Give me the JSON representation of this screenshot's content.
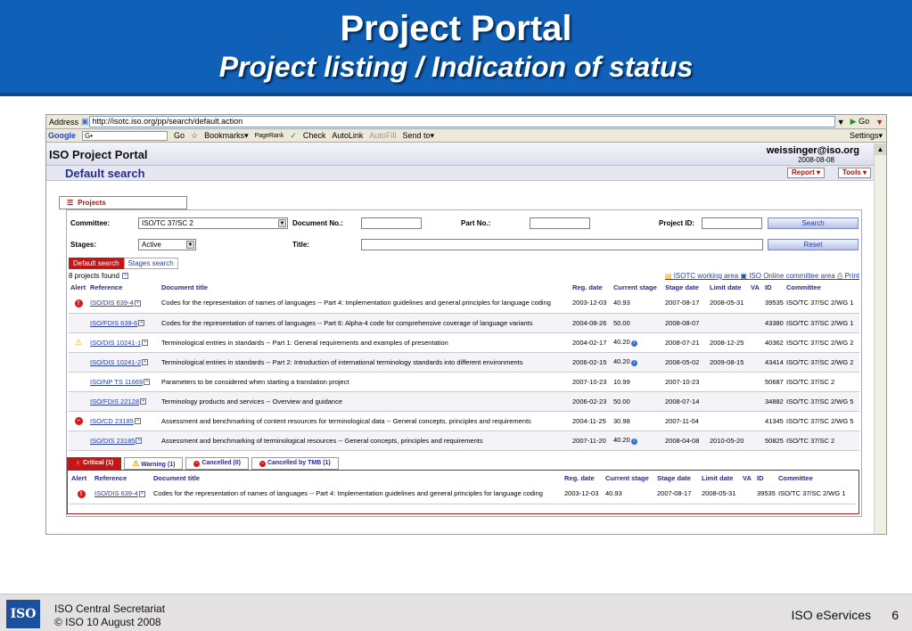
{
  "slide": {
    "title": "Project Portal",
    "subtitle": "Project listing / Indication of status"
  },
  "browser": {
    "address_label": "Address",
    "url": "http://isotc.iso.org/pp/search/default.action",
    "go_label": "Go",
    "google_label": "Google",
    "google_input": "G•",
    "toolbar_go": "Go",
    "bookmarks": "Bookmarks▾",
    "pagerank": "PageRank",
    "check": "Check",
    "autolink": "AutoLink",
    "autofill": "AutoFill",
    "send_to": "Send to▾",
    "settings": "Settings▾"
  },
  "portal": {
    "title": "ISO Project Portal",
    "user": "weissinger@iso.org",
    "date": "2008-08-08",
    "subtitle": "Default search",
    "report_btn": "Report",
    "tools_btn": "Tools"
  },
  "projects_tab": "Projects",
  "form": {
    "committee_label": "Committee:",
    "committee_value": "ISO/TC 37/SC 2",
    "docno_label": "Document No.:",
    "partno_label": "Part No.:",
    "projectid_label": "Project ID:",
    "search_btn": "Search",
    "stages_label": "Stages:",
    "stages_value": "Active",
    "title_label": "Title:",
    "reset_btn": "Reset"
  },
  "subtabs": [
    "Default search",
    "Stages search"
  ],
  "found": "8 projects found",
  "links": {
    "isotc": "ISOTC working area",
    "online": "ISO Online committee area",
    "print": "Print"
  },
  "table": {
    "headers": [
      "Alert",
      "Reference",
      "Document title",
      "Reg. date",
      "Current stage",
      "Stage date",
      "Limit date",
      "VA",
      "ID",
      "Committee"
    ],
    "rows": [
      {
        "alert": "critical",
        "ref": "ISO/DIS 639-4",
        "title": "Codes for the representation of names of languages -- Part 4: Implementation guidelines and general principles for language coding",
        "reg": "2003-12-03",
        "stage": "40.93",
        "stage_date": "2007-08-17",
        "limit": "2008-05-31",
        "va": "",
        "id": "39535",
        "committee": "ISO/TC 37/SC 2/WG 1"
      },
      {
        "alert": "",
        "ref": "ISO/FDIS 639-6",
        "title": "Codes for the representation of names of languages -- Part 6: Alpha-4 code for comprehensive coverage of language variants",
        "reg": "2004-08-26",
        "stage": "50.00",
        "stage_date": "2008-08-07",
        "limit": "",
        "va": "",
        "id": "43380",
        "committee": "ISO/TC 37/SC 2/WG 1"
      },
      {
        "alert": "warning",
        "ref": "ISO/DIS 10241-1",
        "title": "Terminological entries in standards -- Part 1: General requirements and examples of presentation",
        "reg": "2004-02-17",
        "stage": "40.20",
        "stage_date": "2008-07-21",
        "limit": "2008-12-25",
        "va": "",
        "id": "40362",
        "committee": "ISO/TC 37/SC 2/WG 2"
      },
      {
        "alert": "",
        "ref": "ISO/DIS 10241-2",
        "title": "Terminological entries in standards -- Part 2: Introduction of international terminology standards into different environments",
        "reg": "2006-02-15",
        "stage": "40.20",
        "stage_date": "2008-05-02",
        "limit": "2009-08-15",
        "va": "",
        "id": "43414",
        "committee": "ISO/TC 37/SC 2/WG 2"
      },
      {
        "alert": "",
        "ref": "ISO/NP TS 11669",
        "title": "Parameters to be considered when starting a translation project",
        "reg": "2007-10-23",
        "stage": "10.99",
        "stage_date": "2007-10-23",
        "limit": "",
        "va": "",
        "id": "50687",
        "committee": "ISO/TC 37/SC 2"
      },
      {
        "alert": "",
        "ref": "ISO/FDIS 22128",
        "title": "Terminology products and services -- Overview and guidance",
        "reg": "2006-02-23",
        "stage": "50.00",
        "stage_date": "2008-07-14",
        "limit": "",
        "va": "",
        "id": "34882",
        "committee": "ISO/TC 37/SC 2/WG 5"
      },
      {
        "alert": "cancelled",
        "ref": "ISO/CD 23185",
        "title": "Assessment and benchmarking of content resources for terminological data -- General concepts, principles and requirements",
        "reg": "2004-11-25",
        "stage": "30.98",
        "stage_date": "2007-11-04",
        "limit": "",
        "va": "",
        "id": "41345",
        "committee": "ISO/TC 37/SC 2/WG 5"
      },
      {
        "alert": "",
        "ref": "ISO/DIS 23185",
        "title": "Assessment and benchmarking of terminological resources -- General concepts, principles and requirements",
        "reg": "2007-11-20",
        "stage": "40.20",
        "stage_date": "2008-04-08",
        "limit": "2010-05-20",
        "va": "",
        "id": "50825",
        "committee": "ISO/TC 37/SC 2"
      }
    ]
  },
  "alert_tabs": [
    "Critical (1)",
    "Warning (1)",
    "Cancelled (0)",
    "Cancelled by TMB (1)"
  ],
  "alert_table": {
    "headers": [
      "Alert",
      "Reference",
      "Document title",
      "Reg. date",
      "Current stage",
      "Stage date",
      "Limit date",
      "VA",
      "ID",
      "Committee"
    ],
    "rows": [
      {
        "alert": "critical",
        "ref": "ISO/DIS 639-4",
        "title": "Codes for the representation of names of languages -- Part 4: Implementation guidelines and general principles for language coding",
        "reg": "2003-12-03",
        "stage": "40.93",
        "stage_date": "2007-08-17",
        "limit": "2008-05-31",
        "va": "",
        "id": "39535",
        "committee": "ISO/TC 37/SC 2/WG 1"
      }
    ]
  },
  "footer": {
    "logo": "ISO",
    "org": "ISO Central Secretariat",
    "copyright": "© ISO 10 August 2008",
    "service": "ISO eServices",
    "page": "6"
  }
}
